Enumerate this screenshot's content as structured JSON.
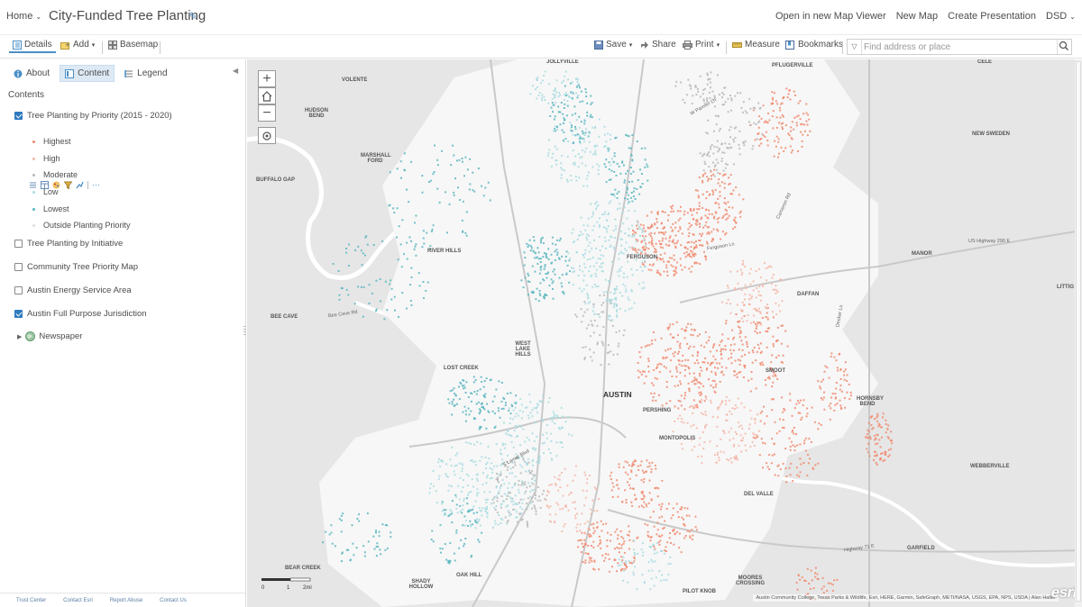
{
  "header": {
    "home_label": "Home",
    "map_title": "City-Funded Tree Planting",
    "links": [
      "Open in new Map Viewer",
      "New Map",
      "Create Presentation"
    ],
    "user": "DSD"
  },
  "toolbar": {
    "details": "Details",
    "add": "Add",
    "basemap": "Basemap",
    "save": "Save",
    "share": "Share",
    "print": "Print",
    "measure": "Measure",
    "bookmarks": "Bookmarks",
    "search_placeholder": "Find address or place"
  },
  "panel": {
    "tabs": [
      "About",
      "Content",
      "Legend"
    ],
    "contents_heading": "Contents",
    "layers": [
      {
        "label": "Tree Planting by Priority (2015 - 2020)",
        "checked": true
      },
      {
        "label": "Tree Planting by Initiative",
        "checked": false
      },
      {
        "label": "Community Tree Priority Map",
        "checked": false
      },
      {
        "label": "Austin Energy Service Area",
        "checked": false
      },
      {
        "label": "Austin Full Purpose Jurisdiction",
        "checked": true
      }
    ],
    "legend": [
      {
        "label": "Highest",
        "color": "#f08a6e"
      },
      {
        "label": "High",
        "color": "#f4b7a8"
      },
      {
        "label": "Moderate",
        "color": "#b9b9b9"
      },
      {
        "label": "Low",
        "color": "#a9dce0"
      },
      {
        "label": "Lowest",
        "color": "#5ab6c0"
      },
      {
        "label": "Outside Planting Priority",
        "color": "#dddddd"
      }
    ],
    "basemap_group": "Newspaper",
    "footer": [
      "Trust Center",
      "Contact Esri",
      "Report Abuse",
      "Contact Us"
    ]
  },
  "map": {
    "places": [
      {
        "name": "JOLLYVILLE",
        "big": false
      },
      {
        "name": "PFLUGERVILLE",
        "big": false
      },
      {
        "name": "VOLENTE",
        "big": false
      },
      {
        "name": "HUDSON BEND",
        "big": false
      },
      {
        "name": "MARSHALL FORD",
        "big": false
      },
      {
        "name": "BUFFALO GAP",
        "big": false
      },
      {
        "name": "NEW SWEDEN",
        "big": false
      },
      {
        "name": "RIVER HILLS",
        "big": false
      },
      {
        "name": "WEST LAKE HILLS",
        "big": false
      },
      {
        "name": "LOST CREEK",
        "big": false
      },
      {
        "name": "AUSTIN",
        "big": true
      },
      {
        "name": "MANOR",
        "big": false
      },
      {
        "name": "DAFFAN",
        "big": false
      },
      {
        "name": "SMOOT",
        "big": false
      },
      {
        "name": "PERSHING",
        "big": false
      },
      {
        "name": "MONTOPOLIS",
        "big": false
      },
      {
        "name": "DEL VALLE",
        "big": false
      },
      {
        "name": "HORNSBY BEND",
        "big": false
      },
      {
        "name": "WEBBERVILLE",
        "big": false
      },
      {
        "name": "GARFIELD",
        "big": false
      },
      {
        "name": "BEE CAVE",
        "big": false
      },
      {
        "name": "BEAR CREEK",
        "big": false
      },
      {
        "name": "MOORES CROSSING",
        "big": false
      },
      {
        "name": "PILOT KNOB",
        "big": false
      },
      {
        "name": "SHADY HOLLOW",
        "big": false
      },
      {
        "name": "OAK HILL",
        "big": false
      },
      {
        "name": "FERGUSON",
        "big": false
      },
      {
        "name": "CELE",
        "big": false
      },
      {
        "name": "LITTIG",
        "big": false
      }
    ],
    "roads": [
      "US Highway 290 E",
      "Ferguson Ln",
      "Bee Cave Rd",
      "Highway 71 E",
      "Decker Ln",
      "Cameron Rd",
      "S Lamar Blvd",
      "W Parmer Ln"
    ],
    "scale_labels": [
      "0",
      "1",
      "2mi"
    ],
    "attribution": "Austin Community College, Texas Parks & Wildlife, Esri, HERE, Garmin, SafeGraph, METI/NASA, USGS, EPA, NPS, USDA | Alan Halter",
    "logo": "esri"
  }
}
